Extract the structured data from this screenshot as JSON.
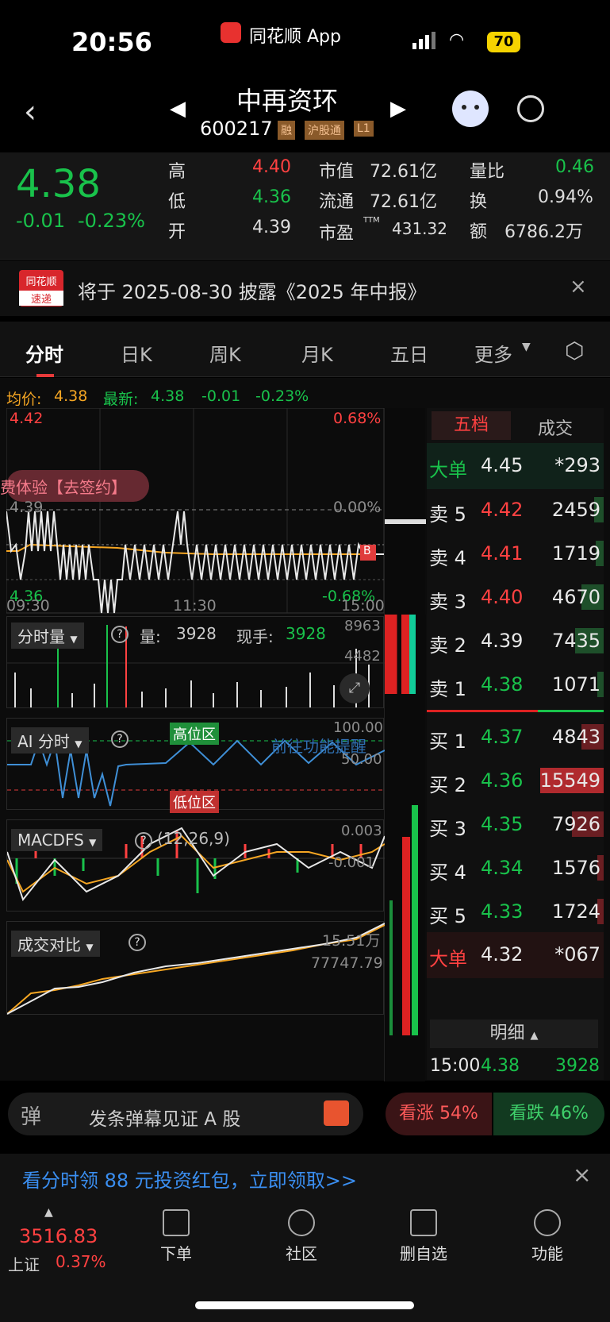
{
  "status": {
    "time": "20:56",
    "app": "同花顺 App",
    "battery": "70"
  },
  "header": {
    "title": "中再资环",
    "code": "600217",
    "tags": [
      "融",
      "沪股通",
      "L1"
    ]
  },
  "quote": {
    "price": "4.38",
    "change": "-0.01",
    "change_pct": "-0.23%",
    "high_label": "高",
    "high": "4.40",
    "low_label": "低",
    "low": "4.36",
    "open_label": "开",
    "open": "4.39",
    "mcap_label": "市值",
    "mcap": "72.61亿",
    "float_label": "流通",
    "float": "72.61亿",
    "pe_label": "市盈",
    "pe_sup": "TTM",
    "pe": "431.32",
    "vr_label": "量比",
    "vr": "0.46",
    "turn_label": "换",
    "turn": "0.94%",
    "amt_label": "额",
    "amt": "6786.2万"
  },
  "notice": {
    "logo1": "同花顺",
    "logo2": "速递",
    "text": "将于 2025-08-30 披露《2025 年中报》"
  },
  "tabs": [
    "分时",
    "日K",
    "周K",
    "月K",
    "五日",
    "更多"
  ],
  "chart": {
    "avg_label": "均价:",
    "avg": "4.38",
    "latest_label": "最新:",
    "latest": "4.38",
    "latest_chg": "-0.01",
    "latest_pct": "-0.23%",
    "ymax": "4.42",
    "ymid": "4.39",
    "ymin": "4.36",
    "pmax": "0.68%",
    "pmid": "0.00%",
    "pmin": "-0.68%",
    "t0": "09:30",
    "t1": "11:30",
    "t2": "15:00",
    "overlay": "费体验【去签约】",
    "b_marker": "B"
  },
  "vol": {
    "title": "分时量",
    "q_label": "量:",
    "q": "3928",
    "now_label": "现手:",
    "now": "3928",
    "max": "8963",
    "mid": "4482"
  },
  "ai": {
    "title": "AI 分时",
    "high_zone": "高位区",
    "low_zone": "低位区",
    "v100": "100.00",
    "v50": "50.00",
    "tip": "前往功能提醒"
  },
  "macd": {
    "title": "MACDFS",
    "params": "(12,26,9)",
    "v1": "0.003",
    "v2": "-0.001"
  },
  "cmp": {
    "title": "成交对比",
    "v1": "15.51万",
    "v2": "77747.79"
  },
  "order": {
    "tab1": "五档",
    "tab2": "成交",
    "big_top": {
      "label": "大单",
      "price": "4.45",
      "vol": "*293"
    },
    "sells": [
      {
        "label": "卖 5",
        "price": "4.42",
        "vol": "2459"
      },
      {
        "label": "卖 4",
        "price": "4.41",
        "vol": "1719"
      },
      {
        "label": "卖 3",
        "price": "4.40",
        "vol": "4670"
      },
      {
        "label": "卖 2",
        "price": "4.39",
        "vol": "7435"
      },
      {
        "label": "卖 1",
        "price": "4.38",
        "vol": "1071"
      }
    ],
    "buys": [
      {
        "label": "买 1",
        "price": "4.37",
        "vol": "4843"
      },
      {
        "label": "买 2",
        "price": "4.36",
        "vol": "15549"
      },
      {
        "label": "买 3",
        "price": "4.35",
        "vol": "7926"
      },
      {
        "label": "买 4",
        "price": "4.34",
        "vol": "1576"
      },
      {
        "label": "买 5",
        "price": "4.33",
        "vol": "1724"
      }
    ],
    "big_bottom": {
      "label": "大单",
      "price": "4.32",
      "vol": "*067"
    },
    "detail": "明细",
    "last": {
      "time": "15:00",
      "price": "4.38",
      "vol": "3928"
    }
  },
  "danmu": {
    "icon": "弹",
    "placeholder": "发条弹幕见证 A 股",
    "up": "看涨 54%",
    "down": "看跌 46%"
  },
  "banner": {
    "text": "看分时领 88 元投资红包，立即领取>>"
  },
  "bottom": {
    "index_value": "3516.83",
    "index_name": "上证",
    "index_pct": "0.37%",
    "nav": [
      "下单",
      "社区",
      "删自选",
      "功能"
    ]
  }
}
